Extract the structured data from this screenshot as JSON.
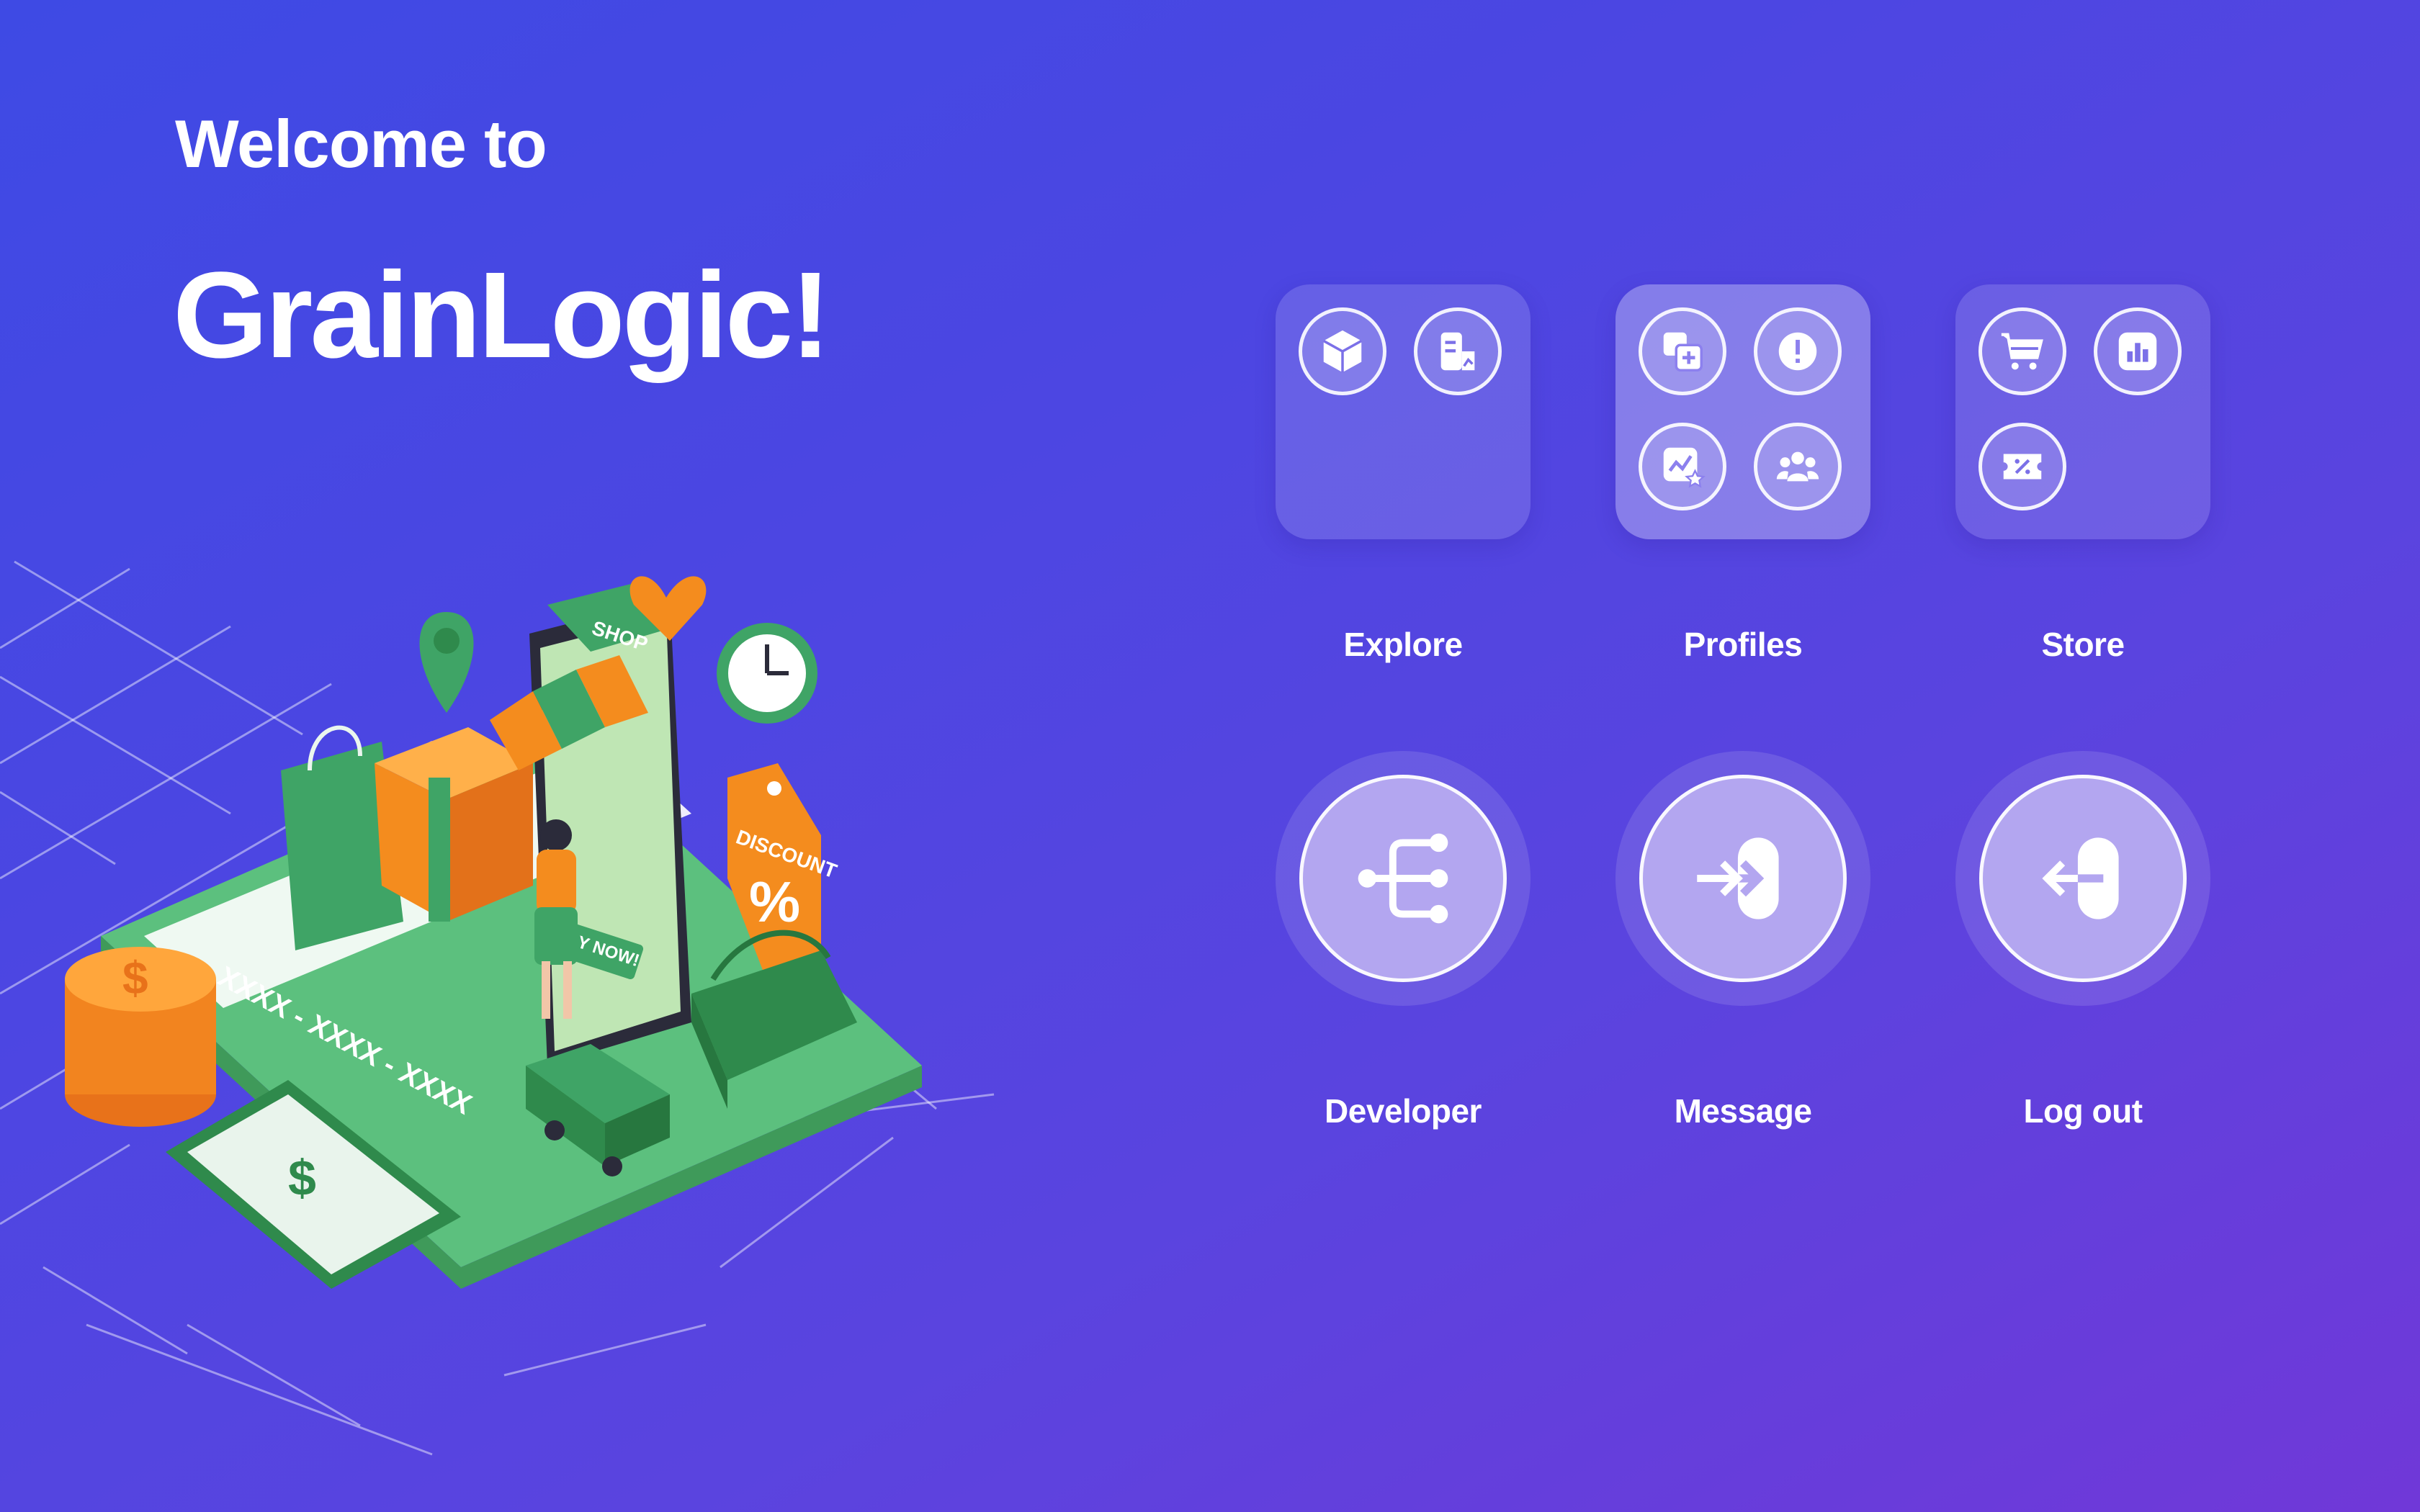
{
  "header": {
    "welcome": "Welcome to",
    "brand": "GrainLogic!"
  },
  "illustration": {
    "shop_sign": "SHOP",
    "discount_tag": "DISCOUNT",
    "percent": "%",
    "buy_now": "Y NOW!",
    "card_number": "XXXX - XXXX - XXXX",
    "coin_symbol": "$",
    "bill_symbol": "$"
  },
  "tiles": [
    {
      "label": "Explore",
      "icons": [
        "box-icon",
        "document-chart-icon"
      ]
    },
    {
      "label": "Profiles",
      "icons": [
        "copy-add-icon",
        "alert-icon",
        "chart-star-icon",
        "group-icon"
      ]
    },
    {
      "label": "Store",
      "icons": [
        "cart-icon",
        "bar-chart-icon",
        "coupon-icon"
      ]
    }
  ],
  "actions": [
    {
      "label": "Developer",
      "icon": "tree-branch-icon"
    },
    {
      "label": "Message",
      "icon": "login-icon"
    },
    {
      "label": "Log out",
      "icon": "logout-icon"
    }
  ],
  "colors": {
    "bg_start": "#3e4ae4",
    "bg_end": "#7038d8",
    "round_fill": "#b3a6f0",
    "illustration_green": "#43b06a",
    "illustration_orange": "#f58a24"
  }
}
